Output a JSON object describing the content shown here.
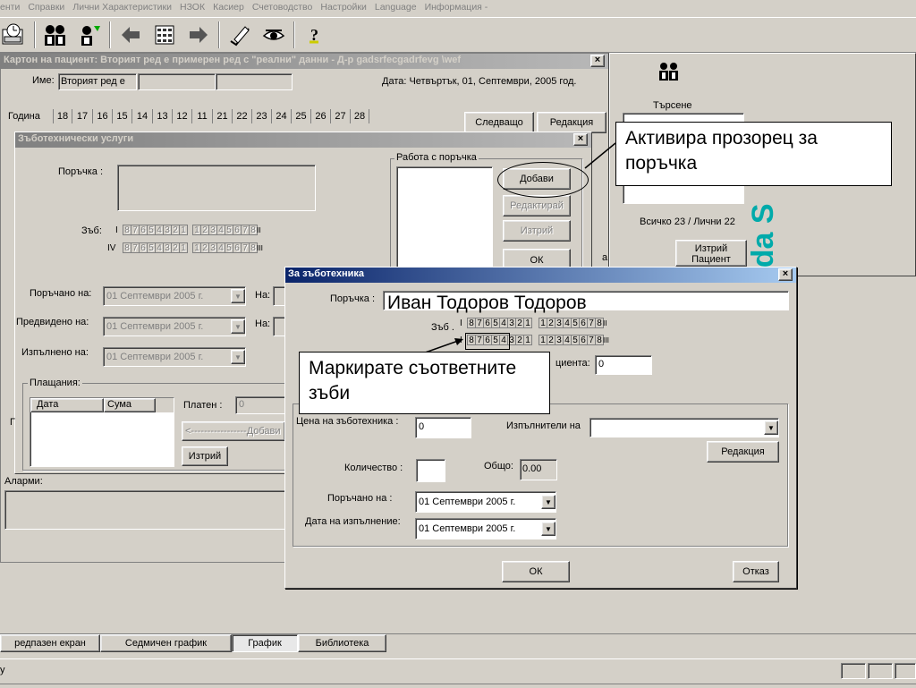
{
  "menu": [
    "енти",
    "Справки",
    "Лични Характеристики",
    "НЗОК",
    "Касиер",
    "Счетоводство",
    "Настройки",
    "Language",
    "Информация -"
  ],
  "toolbar_icons": [
    "calendar-hdd-icon",
    "people-icon",
    "person-icon",
    "back-arrow-icon",
    "calculator-icon",
    "forward-arrow-icon",
    "pen-check-icon",
    "eye-icon",
    "help-icon"
  ],
  "patient_window": {
    "title": "Картон на пациент: Вторият ред е примерен ред с \"реални\" данни  - Д-р gadsrfecgadrfevg \\wef",
    "name_label": "Име:",
    "name_value": "Вторият ред е",
    "date_text": "Дата:  Четвъртък, 01, Септември, 2005 год.",
    "year_label": "Година",
    "teeth_header": [
      "18",
      "17",
      "16",
      "15",
      "14",
      "13",
      "12",
      "11",
      "21",
      "22",
      "23",
      "24",
      "25",
      "26",
      "27",
      "28"
    ],
    "next_button": "Следващо",
    "edit_button": "Редакция",
    "alarms_label": "Аларми:"
  },
  "right_panel": {
    "search_label": "Търсене",
    "count_text": "Всичко 23 / Лични 22",
    "delete_patient": "Изтрий Пациент",
    "brand_text": "uda S"
  },
  "services_dialog": {
    "title": "Зъботехнически услуги",
    "order_label": "Поръчка :",
    "tooth_label": "Зъб:",
    "row1_marker": "I",
    "row1_left": [
      "8",
      "7",
      "6",
      "5",
      "4",
      "3",
      "2",
      "1"
    ],
    "row1_right": [
      "1",
      "2",
      "3",
      "4",
      "5",
      "6",
      "7",
      "8"
    ],
    "row1_suffix": "II",
    "row2_marker": "IV",
    "row2_suffix": "III",
    "ordered_label": "Поръчано на:",
    "ordered_value": "01 Септември 2005 г.",
    "expected_label": "Предвидено на:",
    "expected_value": "01 Септември 2005 г.",
    "completed_label": "Изпълнено на:",
    "completed_value": "01 Септември 2005 г.",
    "on_label": "На:",
    "payments_label": "Плащания:",
    "payments_cols": [
      "Дата",
      "Сума"
    ],
    "paid_label": "Платен :",
    "paid_value": "0",
    "add_payment": "<-----------------Добави",
    "delete_button": "Изтрий",
    "order_work_label": "Работа с поръчка",
    "add_button": "Добави",
    "edit_button": "Редактирай",
    "delete_order": "Изтрий",
    "ok_button": "ОК",
    "partial_g": "Г",
    "partial_a": "а"
  },
  "technician_dialog": {
    "title": "За зъботехника",
    "order_label": "Поръчка :",
    "order_value": "",
    "tooth_label": "Зъб .",
    "row1_marker": "I",
    "row1_left": [
      "8",
      "7",
      "6",
      "5",
      "4",
      "3",
      "2",
      "1"
    ],
    "row1_right": [
      "1",
      "2",
      "3",
      "4",
      "5",
      "6",
      "7",
      "8"
    ],
    "row1_suffix": "II",
    "row2_marker": "I",
    "row2_suffix": "III",
    "patient_label": "циента:",
    "patient_value": "0",
    "price_label": "Цена на зъботехника :",
    "price_value": "0",
    "performers_label": "Изпълнители на",
    "performers_value": "",
    "edit_button": "Редакция",
    "quantity_label": "Количество :",
    "quantity_value": "",
    "total_label": "Общо:",
    "total_value": "0.00",
    "ordered_label": "Поръчано на :",
    "ordered_value": "01 Септември 2005 г.",
    "exec_date_label": "Дата на изпълнение:",
    "exec_date_value": "01 Септември 2005 г.",
    "ok_button": "ОК",
    "cancel_button": "Отказ"
  },
  "callouts": {
    "activate": "Активира прозорец за поръчка",
    "name_overlay": "Иван Тодоров Тодоров",
    "mark": "Маркирате съответните зъби"
  },
  "bottom_tabs": [
    "редпазен екран",
    "Седмичен график",
    "График",
    "Библиотека"
  ],
  "status_left": "у",
  "colors": {
    "face": "#d4d0c8",
    "active_title": "#0a246a",
    "brand": "#0aa"
  }
}
